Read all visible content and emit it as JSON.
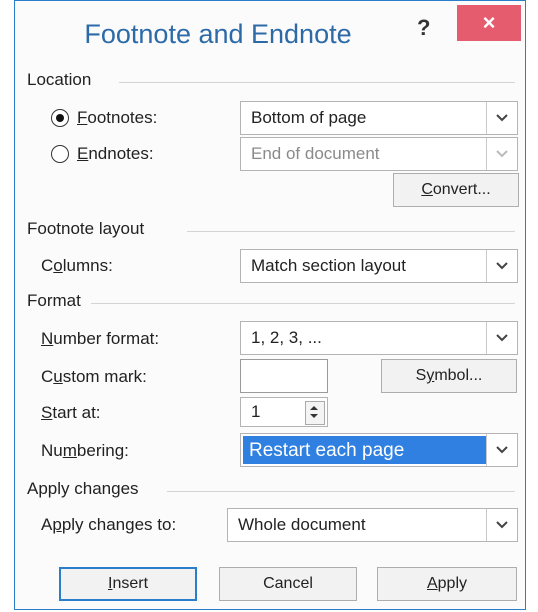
{
  "dialog": {
    "title": "Footnote and Endnote",
    "help_label": "?",
    "close_label": "×"
  },
  "location": {
    "heading": "Location",
    "footnotes": {
      "label_prefix": "",
      "accel": "F",
      "label_rest": "ootnotes:",
      "selected": true,
      "value": "Bottom of page"
    },
    "endnotes": {
      "label_prefix": "",
      "accel": "E",
      "label_rest": "ndnotes:",
      "selected": false,
      "value": "End of document"
    },
    "convert": {
      "prefix": "",
      "accel": "C",
      "rest": "onvert..."
    }
  },
  "layout": {
    "heading": "Footnote layout",
    "columns": {
      "prefix": "C",
      "accel": "o",
      "rest": "lumns:",
      "value": "Match section layout"
    }
  },
  "format": {
    "heading": "Format",
    "number_format": {
      "prefix": "",
      "accel": "N",
      "rest": "umber format:",
      "value": "1, 2, 3, ..."
    },
    "custom_mark": {
      "prefix": "C",
      "accel": "u",
      "rest": "stom mark:",
      "value": ""
    },
    "symbol": {
      "prefix": "S",
      "accel": "y",
      "rest": "mbol..."
    },
    "start_at": {
      "prefix": "",
      "accel": "S",
      "rest": "tart at:",
      "value": "1"
    },
    "numbering": {
      "prefix": "Nu",
      "accel": "m",
      "rest": "bering:",
      "value": "Restart each page"
    }
  },
  "apply_changes": {
    "heading": "Apply changes",
    "apply_to": {
      "prefix": "A",
      "accel": "p",
      "rest": "ply changes to:",
      "value": "Whole document"
    }
  },
  "buttons": {
    "insert": {
      "prefix": "",
      "accel": "I",
      "rest": "nsert"
    },
    "cancel": "Cancel",
    "apply": {
      "prefix": "",
      "accel": "A",
      "rest": "pply"
    }
  },
  "colors": {
    "accent": "#2b7ec9",
    "title_text": "#2d6aa8",
    "close_button": "#e65c6f",
    "highlight": "#2f80e0"
  }
}
